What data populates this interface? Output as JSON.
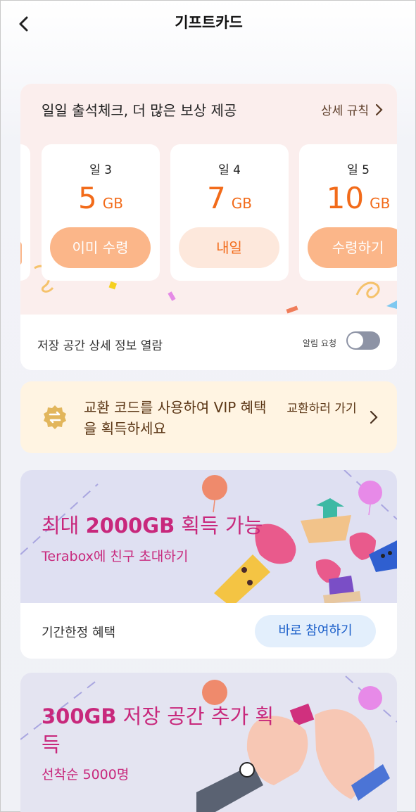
{
  "header": {
    "title": "기프트카드"
  },
  "attendance": {
    "title": "일일 출석체크, 더 많은 보상 제공",
    "rules_label": "상세 규칙",
    "days": [
      {
        "label": "일 3",
        "amount": "5",
        "unit": "GB",
        "button": "이미 수령"
      },
      {
        "label": "일 4",
        "amount": "7",
        "unit": "GB",
        "button": "내일"
      },
      {
        "label": "일 5",
        "amount": "10",
        "unit": "GB",
        "button": "수령하기"
      }
    ],
    "storage_label": "저장 공간 상세 정보 열람",
    "notify_label": "알림 요청",
    "notify_on": false
  },
  "redeem": {
    "text": "교환 코드를 사용하여 VIP 혜택을 획득하세요",
    "go_label": "교환하러 가기"
  },
  "invite": {
    "headline_prefix": "최대 ",
    "headline_bold": "2000GB",
    "headline_suffix": " 획득 가능",
    "subtitle": "Terabox에 친구 초대하기",
    "limited_label": "기간한정 혜택",
    "button": "바로 참여하기"
  },
  "storage_offer": {
    "headline_bold": "300GB",
    "headline_rest": " 저장 공간 추가 획득",
    "subtitle": "선착순 5000명"
  },
  "colors": {
    "accent_orange": "#f26b1a",
    "accent_pink": "#c8287c",
    "link_blue": "#1a5ec9"
  }
}
